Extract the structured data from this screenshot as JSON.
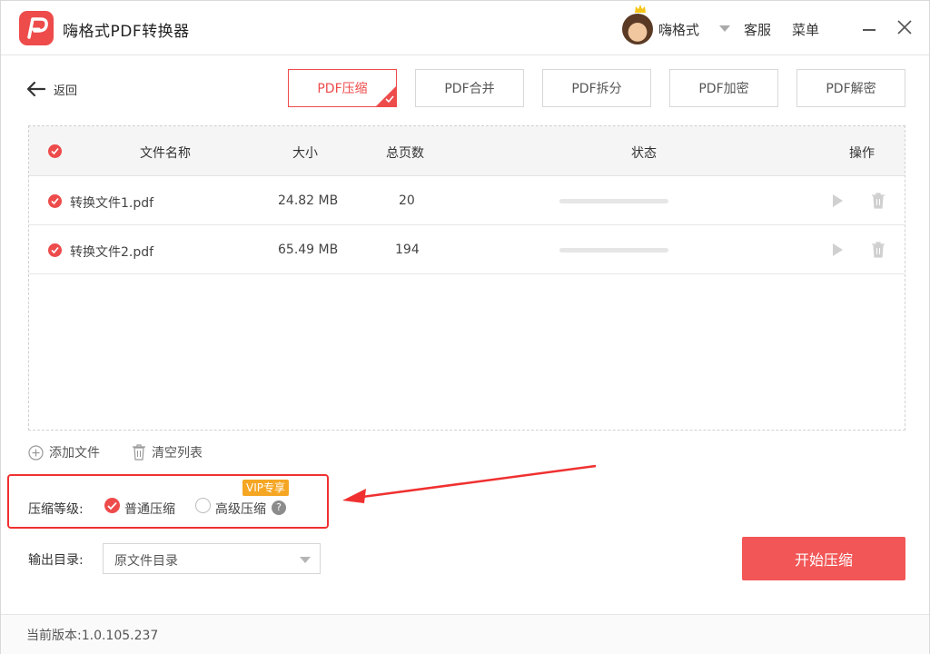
{
  "app": {
    "title": "嗨格式PDF转换器",
    "user_name": "嗨格式",
    "service_label": "客服",
    "menu_label": "菜单"
  },
  "nav": {
    "back_label": "返回",
    "tabs": [
      {
        "label": "PDF压缩",
        "active": true
      },
      {
        "label": "PDF合并",
        "active": false
      },
      {
        "label": "PDF拆分",
        "active": false
      },
      {
        "label": "PDF加密",
        "active": false
      },
      {
        "label": "PDF解密",
        "active": false
      }
    ]
  },
  "table": {
    "headers": {
      "name": "文件名称",
      "size": "大小",
      "pages": "总页数",
      "status": "状态",
      "actions": "操作"
    },
    "rows": [
      {
        "name": "转换文件1.pdf",
        "size": "24.82 MB",
        "pages": "20",
        "progress": 0
      },
      {
        "name": "转换文件2.pdf",
        "size": "65.49 MB",
        "pages": "194",
        "progress": 0
      }
    ]
  },
  "tools": {
    "add_file_label": "添加文件",
    "clear_list_label": "清空列表"
  },
  "compression": {
    "label": "压缩等级:",
    "normal_label": "普通压缩",
    "advanced_label": "高级压缩",
    "vip_badge": "VIP专享",
    "help_glyph": "?",
    "selected": "normal"
  },
  "output": {
    "label": "输出目录:",
    "selected_value": "原文件目录"
  },
  "actions": {
    "start_label": "开始压缩"
  },
  "footer": {
    "version_text": "当前版本:1.0.105.237"
  },
  "colors": {
    "accent": "#ee4b4b",
    "highlight": "#f03030",
    "vip": "#f5a623"
  }
}
